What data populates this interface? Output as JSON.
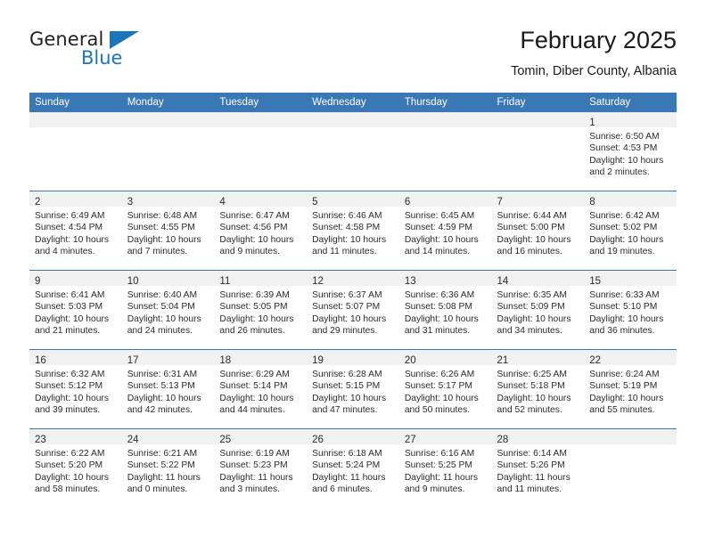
{
  "brand": {
    "name_part1": "General",
    "name_part2": "Blue",
    "accent_color": "#1b75bc"
  },
  "header": {
    "title": "February 2025",
    "subtitle": "Tomin, Diber County, Albania"
  },
  "calendar": {
    "header_color": "#3a78b5",
    "daynum_band_color": "#f1f1f1",
    "weekday_headers": [
      "Sunday",
      "Monday",
      "Tuesday",
      "Wednesday",
      "Thursday",
      "Friday",
      "Saturday"
    ],
    "weeks": [
      [
        {
          "blank": true
        },
        {
          "blank": true
        },
        {
          "blank": true
        },
        {
          "blank": true
        },
        {
          "blank": true
        },
        {
          "blank": true
        },
        {
          "day": "1",
          "sunrise": "Sunrise: 6:50 AM",
          "sunset": "Sunset: 4:53 PM",
          "daylight1": "Daylight: 10 hours",
          "daylight2": "and 2 minutes."
        }
      ],
      [
        {
          "day": "2",
          "sunrise": "Sunrise: 6:49 AM",
          "sunset": "Sunset: 4:54 PM",
          "daylight1": "Daylight: 10 hours",
          "daylight2": "and 4 minutes."
        },
        {
          "day": "3",
          "sunrise": "Sunrise: 6:48 AM",
          "sunset": "Sunset: 4:55 PM",
          "daylight1": "Daylight: 10 hours",
          "daylight2": "and 7 minutes."
        },
        {
          "day": "4",
          "sunrise": "Sunrise: 6:47 AM",
          "sunset": "Sunset: 4:56 PM",
          "daylight1": "Daylight: 10 hours",
          "daylight2": "and 9 minutes."
        },
        {
          "day": "5",
          "sunrise": "Sunrise: 6:46 AM",
          "sunset": "Sunset: 4:58 PM",
          "daylight1": "Daylight: 10 hours",
          "daylight2": "and 11 minutes."
        },
        {
          "day": "6",
          "sunrise": "Sunrise: 6:45 AM",
          "sunset": "Sunset: 4:59 PM",
          "daylight1": "Daylight: 10 hours",
          "daylight2": "and 14 minutes."
        },
        {
          "day": "7",
          "sunrise": "Sunrise: 6:44 AM",
          "sunset": "Sunset: 5:00 PM",
          "daylight1": "Daylight: 10 hours",
          "daylight2": "and 16 minutes."
        },
        {
          "day": "8",
          "sunrise": "Sunrise: 6:42 AM",
          "sunset": "Sunset: 5:02 PM",
          "daylight1": "Daylight: 10 hours",
          "daylight2": "and 19 minutes."
        }
      ],
      [
        {
          "day": "9",
          "sunrise": "Sunrise: 6:41 AM",
          "sunset": "Sunset: 5:03 PM",
          "daylight1": "Daylight: 10 hours",
          "daylight2": "and 21 minutes."
        },
        {
          "day": "10",
          "sunrise": "Sunrise: 6:40 AM",
          "sunset": "Sunset: 5:04 PM",
          "daylight1": "Daylight: 10 hours",
          "daylight2": "and 24 minutes."
        },
        {
          "day": "11",
          "sunrise": "Sunrise: 6:39 AM",
          "sunset": "Sunset: 5:05 PM",
          "daylight1": "Daylight: 10 hours",
          "daylight2": "and 26 minutes."
        },
        {
          "day": "12",
          "sunrise": "Sunrise: 6:37 AM",
          "sunset": "Sunset: 5:07 PM",
          "daylight1": "Daylight: 10 hours",
          "daylight2": "and 29 minutes."
        },
        {
          "day": "13",
          "sunrise": "Sunrise: 6:36 AM",
          "sunset": "Sunset: 5:08 PM",
          "daylight1": "Daylight: 10 hours",
          "daylight2": "and 31 minutes."
        },
        {
          "day": "14",
          "sunrise": "Sunrise: 6:35 AM",
          "sunset": "Sunset: 5:09 PM",
          "daylight1": "Daylight: 10 hours",
          "daylight2": "and 34 minutes."
        },
        {
          "day": "15",
          "sunrise": "Sunrise: 6:33 AM",
          "sunset": "Sunset: 5:10 PM",
          "daylight1": "Daylight: 10 hours",
          "daylight2": "and 36 minutes."
        }
      ],
      [
        {
          "day": "16",
          "sunrise": "Sunrise: 6:32 AM",
          "sunset": "Sunset: 5:12 PM",
          "daylight1": "Daylight: 10 hours",
          "daylight2": "and 39 minutes."
        },
        {
          "day": "17",
          "sunrise": "Sunrise: 6:31 AM",
          "sunset": "Sunset: 5:13 PM",
          "daylight1": "Daylight: 10 hours",
          "daylight2": "and 42 minutes."
        },
        {
          "day": "18",
          "sunrise": "Sunrise: 6:29 AM",
          "sunset": "Sunset: 5:14 PM",
          "daylight1": "Daylight: 10 hours",
          "daylight2": "and 44 minutes."
        },
        {
          "day": "19",
          "sunrise": "Sunrise: 6:28 AM",
          "sunset": "Sunset: 5:15 PM",
          "daylight1": "Daylight: 10 hours",
          "daylight2": "and 47 minutes."
        },
        {
          "day": "20",
          "sunrise": "Sunrise: 6:26 AM",
          "sunset": "Sunset: 5:17 PM",
          "daylight1": "Daylight: 10 hours",
          "daylight2": "and 50 minutes."
        },
        {
          "day": "21",
          "sunrise": "Sunrise: 6:25 AM",
          "sunset": "Sunset: 5:18 PM",
          "daylight1": "Daylight: 10 hours",
          "daylight2": "and 52 minutes."
        },
        {
          "day": "22",
          "sunrise": "Sunrise: 6:24 AM",
          "sunset": "Sunset: 5:19 PM",
          "daylight1": "Daylight: 10 hours",
          "daylight2": "and 55 minutes."
        }
      ],
      [
        {
          "day": "23",
          "sunrise": "Sunrise: 6:22 AM",
          "sunset": "Sunset: 5:20 PM",
          "daylight1": "Daylight: 10 hours",
          "daylight2": "and 58 minutes."
        },
        {
          "day": "24",
          "sunrise": "Sunrise: 6:21 AM",
          "sunset": "Sunset: 5:22 PM",
          "daylight1": "Daylight: 11 hours",
          "daylight2": "and 0 minutes."
        },
        {
          "day": "25",
          "sunrise": "Sunrise: 6:19 AM",
          "sunset": "Sunset: 5:23 PM",
          "daylight1": "Daylight: 11 hours",
          "daylight2": "and 3 minutes."
        },
        {
          "day": "26",
          "sunrise": "Sunrise: 6:18 AM",
          "sunset": "Sunset: 5:24 PM",
          "daylight1": "Daylight: 11 hours",
          "daylight2": "and 6 minutes."
        },
        {
          "day": "27",
          "sunrise": "Sunrise: 6:16 AM",
          "sunset": "Sunset: 5:25 PM",
          "daylight1": "Daylight: 11 hours",
          "daylight2": "and 9 minutes."
        },
        {
          "day": "28",
          "sunrise": "Sunrise: 6:14 AM",
          "sunset": "Sunset: 5:26 PM",
          "daylight1": "Daylight: 11 hours",
          "daylight2": "and 11 minutes."
        },
        {
          "blank": true
        }
      ]
    ]
  }
}
